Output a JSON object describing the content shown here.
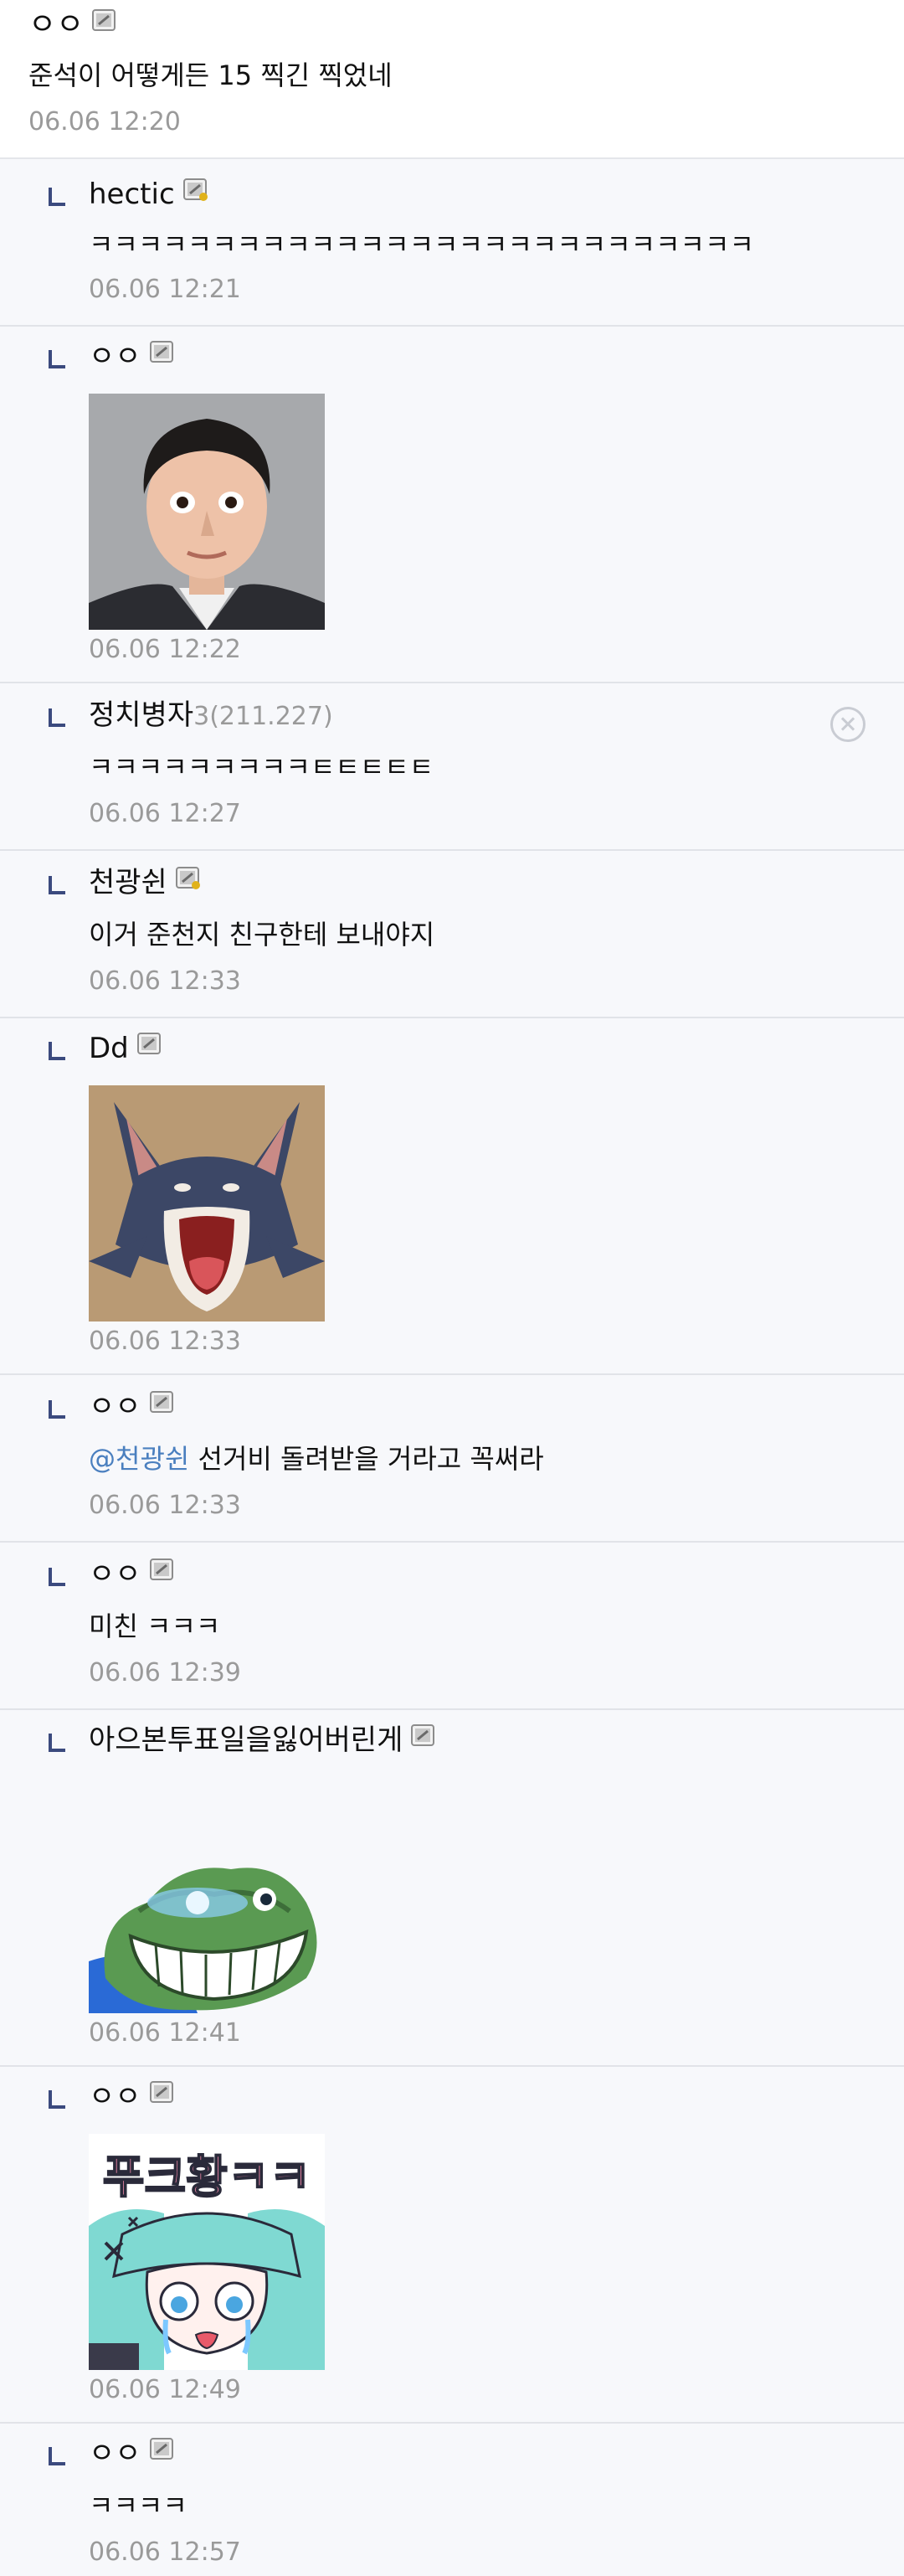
{
  "comments": [
    {
      "nickname": "ㅇㅇ",
      "text": "준석이 어떻게든 15 찍긴 찍었네",
      "date": "06.06 12:20"
    },
    {
      "nickname": "hectic",
      "text": "ㅋㅋㅋㅋㅋㅋㅋㅋㅋㅋㅋㅋㅋㅋㅋㅋㅋㅋㅋㅋㅋㅋㅋㅋㅋㅋㅋ",
      "date": "06.06 12:21"
    },
    {
      "nickname": "ㅇㅇ",
      "date": "06.06 12:22"
    },
    {
      "nickname": "정치병자",
      "ip": "3(211.227)",
      "text": "ㅋㅋㅋㅋㅋㅋㅋㅋㅋㅌㅌㅌㅌㅌ",
      "date": "06.06 12:27"
    },
    {
      "nickname": "천광쉰",
      "text": "이거 준천지 친구한테 보내야지",
      "date": "06.06 12:33"
    },
    {
      "nickname": "Dd",
      "date": "06.06 12:33"
    },
    {
      "nickname": "ㅇㅇ",
      "mention": "@천광쉰",
      "text": " 선거비 돌려받을 거라고 꼭써라",
      "date": "06.06 12:33"
    },
    {
      "nickname": "ㅇㅇ",
      "text": "미친 ㅋㅋㅋ",
      "date": "06.06 12:39"
    },
    {
      "nickname": "아으본투표일을잃어버린게",
      "date": "06.06 12:41"
    },
    {
      "nickname": "ㅇㅇ",
      "date": "06.06 12:49",
      "sticker_text": "푸크황ㅋㅋ"
    },
    {
      "nickname": "ㅇㅇ",
      "text": "ㅋㅋㅋㅋ",
      "date": "06.06 12:57"
    }
  ],
  "colors": {
    "reply_bg": "#f7f8fb",
    "divider": "#e1e3e8",
    "reply_arrow": "#3b4a7e",
    "date_text": "#9a9a9a",
    "mention": "#4a7fbf"
  },
  "icons": {
    "fixed_nick": "fixed-nick-icon",
    "fixed_nick_manager": "fixed-nick-key-icon",
    "reply": "reply-arrow-icon",
    "delete": "delete-circle-x-icon"
  }
}
